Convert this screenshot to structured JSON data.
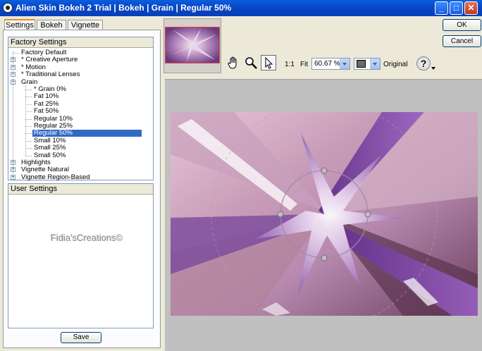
{
  "window": {
    "title": "Alien Skin Bokeh 2 Trial | Bokeh | Grain | Regular  50%",
    "minimize_glyph": "_",
    "maximize_glyph": "□",
    "close_glyph": "✕"
  },
  "tabs": [
    {
      "label": "Settings",
      "active": true
    },
    {
      "label": "Bokeh",
      "active": false
    },
    {
      "label": "Vignette",
      "active": false
    }
  ],
  "factory_settings": {
    "header": "Factory Settings",
    "items": [
      {
        "label": "Factory Default",
        "level": 0,
        "expander": ""
      },
      {
        "label": "* Creative Aperture",
        "level": 0,
        "expander": "+"
      },
      {
        "label": "* Motion",
        "level": 0,
        "expander": "+"
      },
      {
        "label": "* Traditional Lenses",
        "level": 0,
        "expander": "+"
      },
      {
        "label": "Grain",
        "level": 0,
        "expander": "-"
      },
      {
        "label": "* Grain 0%",
        "level": 1,
        "expander": ""
      },
      {
        "label": "Fat  10%",
        "level": 1,
        "expander": ""
      },
      {
        "label": "Fat  25%",
        "level": 1,
        "expander": ""
      },
      {
        "label": "Fat  50%",
        "level": 1,
        "expander": ""
      },
      {
        "label": "Regular  10%",
        "level": 1,
        "expander": ""
      },
      {
        "label": "Regular  25%",
        "level": 1,
        "expander": ""
      },
      {
        "label": "Regular  50%",
        "level": 1,
        "expander": "",
        "selected": true
      },
      {
        "label": "Small  10%",
        "level": 1,
        "expander": ""
      },
      {
        "label": "Small  25%",
        "level": 1,
        "expander": ""
      },
      {
        "label": "Small  50%",
        "level": 1,
        "expander": ""
      },
      {
        "label": "Highlights",
        "level": 0,
        "expander": "+"
      },
      {
        "label": "Vignette Natural",
        "level": 0,
        "expander": "+"
      },
      {
        "label": "Vignette Region-Based",
        "level": 0,
        "expander": "+"
      }
    ]
  },
  "user_settings": {
    "header": "User Settings",
    "watermark": "Fidia'sCreations©"
  },
  "save_label": "Save",
  "toolbar": {
    "hand_icon": "hand-icon",
    "zoom_icon": "magnifier-icon",
    "pointer_icon": "arrow-pointer-icon",
    "zoom_1to1": "1:1",
    "fit_label": "Fit",
    "zoom_value": "60.67 %",
    "original_label": "Original",
    "help_glyph": "?"
  },
  "ok_label": "OK",
  "cancel_label": "Cancel",
  "colors": {
    "selection": "#316ac5",
    "title_bar": "#0848c8",
    "preview_bg": "#c0c0c0",
    "thumb_border": "#e04040"
  }
}
